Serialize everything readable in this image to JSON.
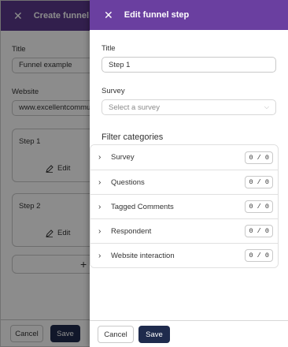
{
  "background": {
    "title": "Create funnel",
    "title_label": "Title",
    "title_value": "Funnel example",
    "website_label": "Website",
    "website_value": "www.excellentcommun",
    "steps": [
      {
        "title": "Step 1",
        "edit_label": "Edit"
      },
      {
        "title": "Step 2",
        "edit_label": "Edit"
      }
    ],
    "add_icon": "plus-icon",
    "cancel_label": "Cancel",
    "save_label": "Save"
  },
  "panel": {
    "header_title": "Edit funnel step",
    "title_label": "Title",
    "title_value": "Step 1",
    "survey_label": "Survey",
    "survey_placeholder": "Select a survey",
    "filter_title": "Filter categories",
    "filters": [
      {
        "label": "Survey",
        "count": "0 / 0"
      },
      {
        "label": "Questions",
        "count": "0 / 0"
      },
      {
        "label": "Tagged Comments",
        "count": "0 / 0"
      },
      {
        "label": "Respondent",
        "count": "0 / 0"
      },
      {
        "label": "Website interaction",
        "count": "0 / 0"
      }
    ],
    "cancel_label": "Cancel",
    "save_label": "Save"
  },
  "colors": {
    "header_purple": "#6a3fa0",
    "primary_button": "#1f2b4d"
  }
}
